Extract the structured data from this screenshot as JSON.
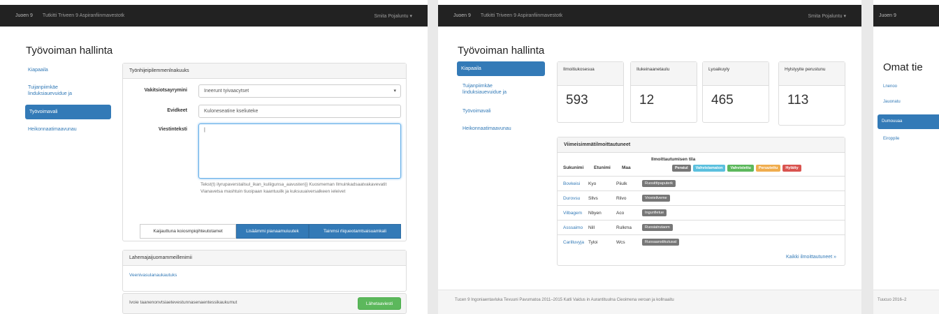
{
  "nav": {
    "brand": "Juoen 9",
    "title": "Tutkitti Triveen 9 Aspiranfiinmavestotk",
    "user": "Smita Pojaluntu"
  },
  "page_title": "Työvoiman hallinta",
  "frame3_title": "Omat tie",
  "sidebar": [
    "Kiapaaila",
    "Tuijanpiimkäe linduksiauevuidue ja",
    "Työvoimavali",
    "Heikonnaatimaavunau"
  ],
  "form": {
    "panel_title": "Työnhijeipilemmenlnakuuks",
    "label1": "Vakitsiotsayrymini",
    "select_value": "Ineerunt tyivaacytset",
    "label2": "Evidkeet",
    "input2_value": "Kuloneseatine kseliuteke",
    "label3": "Viestinteksti",
    "help": "Tekst(t) ilyrupaverstailsul_ikan_kuliigunsa_aavusten}} Kuosmeman Ilmuinkadsaatvakavevatit Vianavetsa mashtuin tiuoipaan kaantuuilk ja kuksuuaiversalkeen ieleivet",
    "btn1": "Kaijauttuna koiosmpiqihteutotamet",
    "btn2": "Lisäämmi pianaamuiuutek",
    "btn3": "Tainmsi rliqueotamtsaisuamkali"
  },
  "panel2": {
    "title": "Lahemajaijuomammeillenimii",
    "text": "Veenivasulanaukautuks"
  },
  "panel3": {
    "text": "Ivoie taanenonvtsiaetevestunnasenaentessikaukumut",
    "button": "Lähetaaviesti"
  },
  "stats": [
    {
      "label": "Ilmoitiukosesua",
      "value": "593"
    },
    {
      "label": "Ilukeinaanetaulu",
      "value": "12"
    },
    {
      "label": "Lyoaikuyly",
      "value": "465"
    },
    {
      "label": "Hylstyyite perustunu",
      "value": "113"
    }
  ],
  "table": {
    "title": "Viimeisimmätilmoittautuneet",
    "headers": [
      "Sukunimi",
      "Etunimi",
      "Maa",
      "Ilmoittautumisen"
    ],
    "badge_caption": "tila",
    "legend": [
      {
        "label": "Peratul",
        "color": "#777777"
      },
      {
        "label": "Vahvistamaton",
        "color": "#5bc0de"
      },
      {
        "label": "Vahvistettu",
        "color": "#5cb85c"
      },
      {
        "label": "Peruutettu",
        "color": "#f0ad4e"
      },
      {
        "label": "Hylätty",
        "color": "#d9534f"
      }
    ],
    "rows": [
      {
        "last": "Bovkeisi",
        "first": "Kyo",
        "country": "Piiulk",
        "status": "Ruositttpaputerk"
      },
      {
        "last": "Durovsu",
        "first": "Sllvs",
        "country": "Rilvo",
        "status": "Vroeieilveme"
      },
      {
        "last": "Vilbagem",
        "first": "Nbyen",
        "country": "Aco",
        "status": "Ingunfietue"
      },
      {
        "last": "Asssaimo",
        "first": "Nill",
        "country": "Rulkma",
        "status": "Ruosiatrutaom"
      },
      {
        "last": "Carilluvyja",
        "first": "Tyloi",
        "country": "Wcs",
        "status": "Ruosaanstikutusat"
      }
    ],
    "more_link": "Kaikki ilmoittautuneet"
  },
  "footer": "Tucen 9 Ingoniaentavluka Tevuuni Pavumatoa 2011–2015 Katli Vaidus in Aurantituulna Cieoimena veroan ja kollnaaitu",
  "frame3_footer": "Tuucuo 2016–2",
  "frame3_menu": [
    "Lnenoo",
    "Jauonatu",
    "Dumouuaa",
    "Eiroppile"
  ]
}
